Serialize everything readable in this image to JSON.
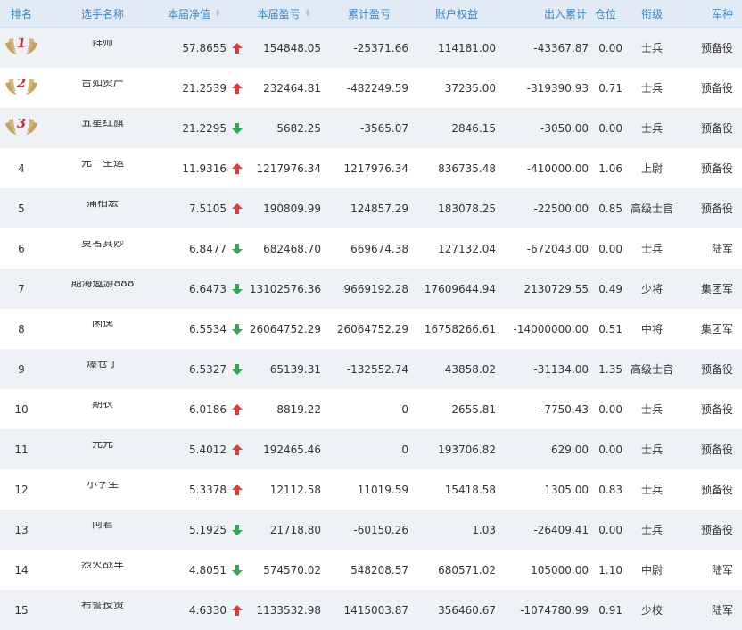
{
  "colors": {
    "header_text": "#3a86c9",
    "up": "#e53935",
    "down": "#2fa84f",
    "medal_gold": "#c9a25a",
    "medal_number": "#d8262c"
  },
  "header": {
    "rank": "排名",
    "name": "选手名称",
    "nav": "本届净值",
    "profit": "本届盈亏",
    "cum_profit": "累计盈亏",
    "equity": "账户权益",
    "inout": "出入累计",
    "position": "仓位",
    "military_rank": "衔级",
    "army": "军种"
  },
  "rows": [
    {
      "rank": "1",
      "name": "拜师",
      "nav": "57.8655",
      "trend": "up",
      "profit": "154848.05",
      "cum": "-25371.66",
      "equity": "114181.00",
      "inout": "-43367.87",
      "pos": "0.00",
      "mrank": "士兵",
      "army": "预备役",
      "medal": true
    },
    {
      "rank": "2",
      "name": "吉如资产",
      "nav": "21.2539",
      "trend": "up",
      "profit": "232464.81",
      "cum": "-482249.59",
      "equity": "37235.00",
      "inout": "-319390.93",
      "pos": "0.71",
      "mrank": "士兵",
      "army": "预备役",
      "medal": true
    },
    {
      "rank": "3",
      "name": "五星红旗",
      "nav": "21.2295",
      "trend": "down",
      "profit": "5682.25",
      "cum": "-3565.07",
      "equity": "2846.15",
      "inout": "-3050.00",
      "pos": "0.00",
      "mrank": "士兵",
      "army": "预备役",
      "medal": true
    },
    {
      "rank": "4",
      "name": "元一生运",
      "nav": "11.9316",
      "trend": "up",
      "profit": "1217976.34",
      "cum": "1217976.34",
      "equity": "836735.48",
      "inout": "-410000.00",
      "pos": "1.06",
      "mrank": "上尉",
      "army": "预备役",
      "medal": false
    },
    {
      "rank": "5",
      "name": "蒲柏宏",
      "nav": "7.5105",
      "trend": "up",
      "profit": "190809.99",
      "cum": "124857.29",
      "equity": "183078.25",
      "inout": "-22500.00",
      "pos": "0.85",
      "mrank": "高级士官",
      "army": "预备役",
      "medal": false
    },
    {
      "rank": "6",
      "name": "莫名其妙",
      "nav": "6.8477",
      "trend": "down",
      "profit": "682468.70",
      "cum": "669674.38",
      "equity": "127132.04",
      "inout": "-672043.00",
      "pos": "0.00",
      "mrank": "士兵",
      "army": "陆军",
      "medal": false
    },
    {
      "rank": "7",
      "name": "期海遨游888",
      "nav": "6.6473",
      "trend": "down",
      "profit": "13102576.36",
      "cum": "9669192.28",
      "equity": "17609644.94",
      "inout": "2130729.55",
      "pos": "0.49",
      "mrank": "少将",
      "army": "集团军",
      "medal": false
    },
    {
      "rank": "8",
      "name": "闲逸",
      "nav": "6.5534",
      "trend": "down",
      "profit": "26064752.29",
      "cum": "26064752.29",
      "equity": "16758266.61",
      "inout": "-14000000.00",
      "pos": "0.51",
      "mrank": "中将",
      "army": "集团军",
      "medal": false
    },
    {
      "rank": "9",
      "name": "爆仓了",
      "nav": "6.5327",
      "trend": "down",
      "profit": "65139.31",
      "cum": "-132552.74",
      "equity": "43858.02",
      "inout": "-31134.00",
      "pos": "1.35",
      "mrank": "高级士官",
      "army": "预备役",
      "medal": false
    },
    {
      "rank": "10",
      "name": "期农",
      "nav": "6.0186",
      "trend": "up",
      "profit": "8819.22",
      "cum": "0",
      "equity": "2655.81",
      "inout": "-7750.43",
      "pos": "0.00",
      "mrank": "士兵",
      "army": "预备役",
      "medal": false
    },
    {
      "rank": "11",
      "name": "元元",
      "nav": "5.4012",
      "trend": "up",
      "profit": "192465.46",
      "cum": "0",
      "equity": "193706.82",
      "inout": "629.00",
      "pos": "0.00",
      "mrank": "士兵",
      "army": "预备役",
      "medal": false
    },
    {
      "rank": "12",
      "name": "小学生",
      "nav": "5.3378",
      "trend": "up",
      "profit": "12112.58",
      "cum": "11019.59",
      "equity": "15418.58",
      "inout": "1305.00",
      "pos": "0.83",
      "mrank": "士兵",
      "army": "预备役",
      "medal": false
    },
    {
      "rank": "13",
      "name": "阿君",
      "nav": "5.1925",
      "trend": "down",
      "profit": "21718.80",
      "cum": "-60150.26",
      "equity": "1.03",
      "inout": "-26409.41",
      "pos": "0.00",
      "mrank": "士兵",
      "army": "预备役",
      "medal": false
    },
    {
      "rank": "14",
      "name": "烈火战车",
      "nav": "4.8051",
      "trend": "down",
      "profit": "574570.02",
      "cum": "548208.57",
      "equity": "680571.02",
      "inout": "105000.00",
      "pos": "1.10",
      "mrank": "中尉",
      "army": "陆军",
      "medal": false
    },
    {
      "rank": "15",
      "name": "希譬投资",
      "nav": "4.6330",
      "trend": "up",
      "profit": "1133532.98",
      "cum": "1415003.87",
      "equity": "356460.67",
      "inout": "-1074780.99",
      "pos": "0.91",
      "mrank": "少校",
      "army": "陆军",
      "medal": false
    }
  ]
}
